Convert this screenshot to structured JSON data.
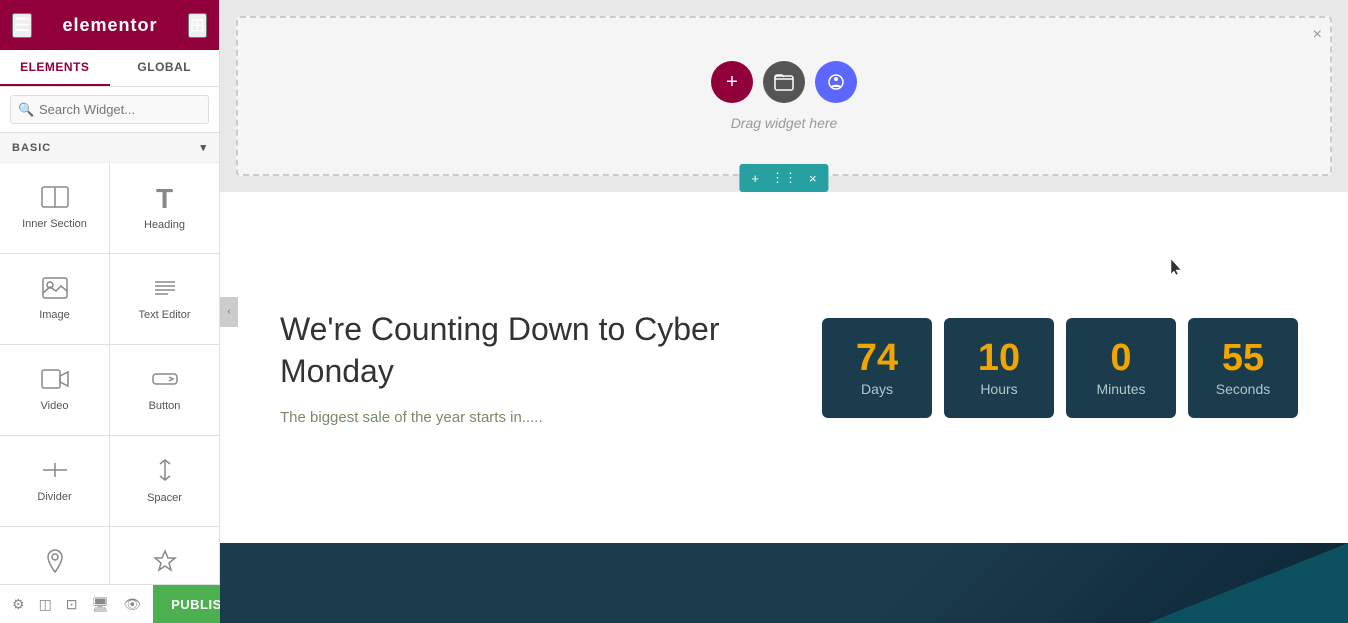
{
  "header": {
    "logo": "elementor",
    "tab_elements": "ELEMENTS",
    "tab_global": "GLOBAL"
  },
  "search": {
    "placeholder": "Search Widget..."
  },
  "section_label": "BASIC",
  "widgets": [
    {
      "id": "inner-section",
      "icon": "▦",
      "label": "Inner Section"
    },
    {
      "id": "heading",
      "icon": "T",
      "label": "Heading"
    },
    {
      "id": "image",
      "icon": "🖼",
      "label": "Image"
    },
    {
      "id": "text-editor",
      "icon": "≡",
      "label": "Text Editor"
    },
    {
      "id": "video",
      "icon": "▶",
      "label": "Video"
    },
    {
      "id": "button",
      "icon": "⟹",
      "label": "Button"
    },
    {
      "id": "divider",
      "icon": "÷",
      "label": "Divider"
    },
    {
      "id": "spacer",
      "icon": "↕",
      "label": "Spacer"
    },
    {
      "id": "google-maps",
      "icon": "📍",
      "label": "Google Maps"
    },
    {
      "id": "icon",
      "icon": "☆",
      "label": "Icon"
    }
  ],
  "footer": {
    "publish_label": "PUBLISH"
  },
  "canvas": {
    "drag_text": "Drag widget here",
    "close_label": "×",
    "section_toolbar": {
      "add": "+",
      "move": "⋮⋮⋮",
      "close": "×"
    }
  },
  "countdown": {
    "title": "We're Counting Down to Cyber Monday",
    "subtitle": "The biggest sale of the year starts in.....",
    "blocks": [
      {
        "value": "74",
        "unit": "Days"
      },
      {
        "value": "10",
        "unit": "Hours"
      },
      {
        "value": "0",
        "unit": "Minutes"
      },
      {
        "value": "55",
        "unit": "Seconds"
      }
    ]
  },
  "colors": {
    "brand": "#92003b",
    "teal": "#26a0a0",
    "dark_blue": "#1a3c4c",
    "gold": "#f0a500",
    "publish_green": "#4caf50"
  }
}
